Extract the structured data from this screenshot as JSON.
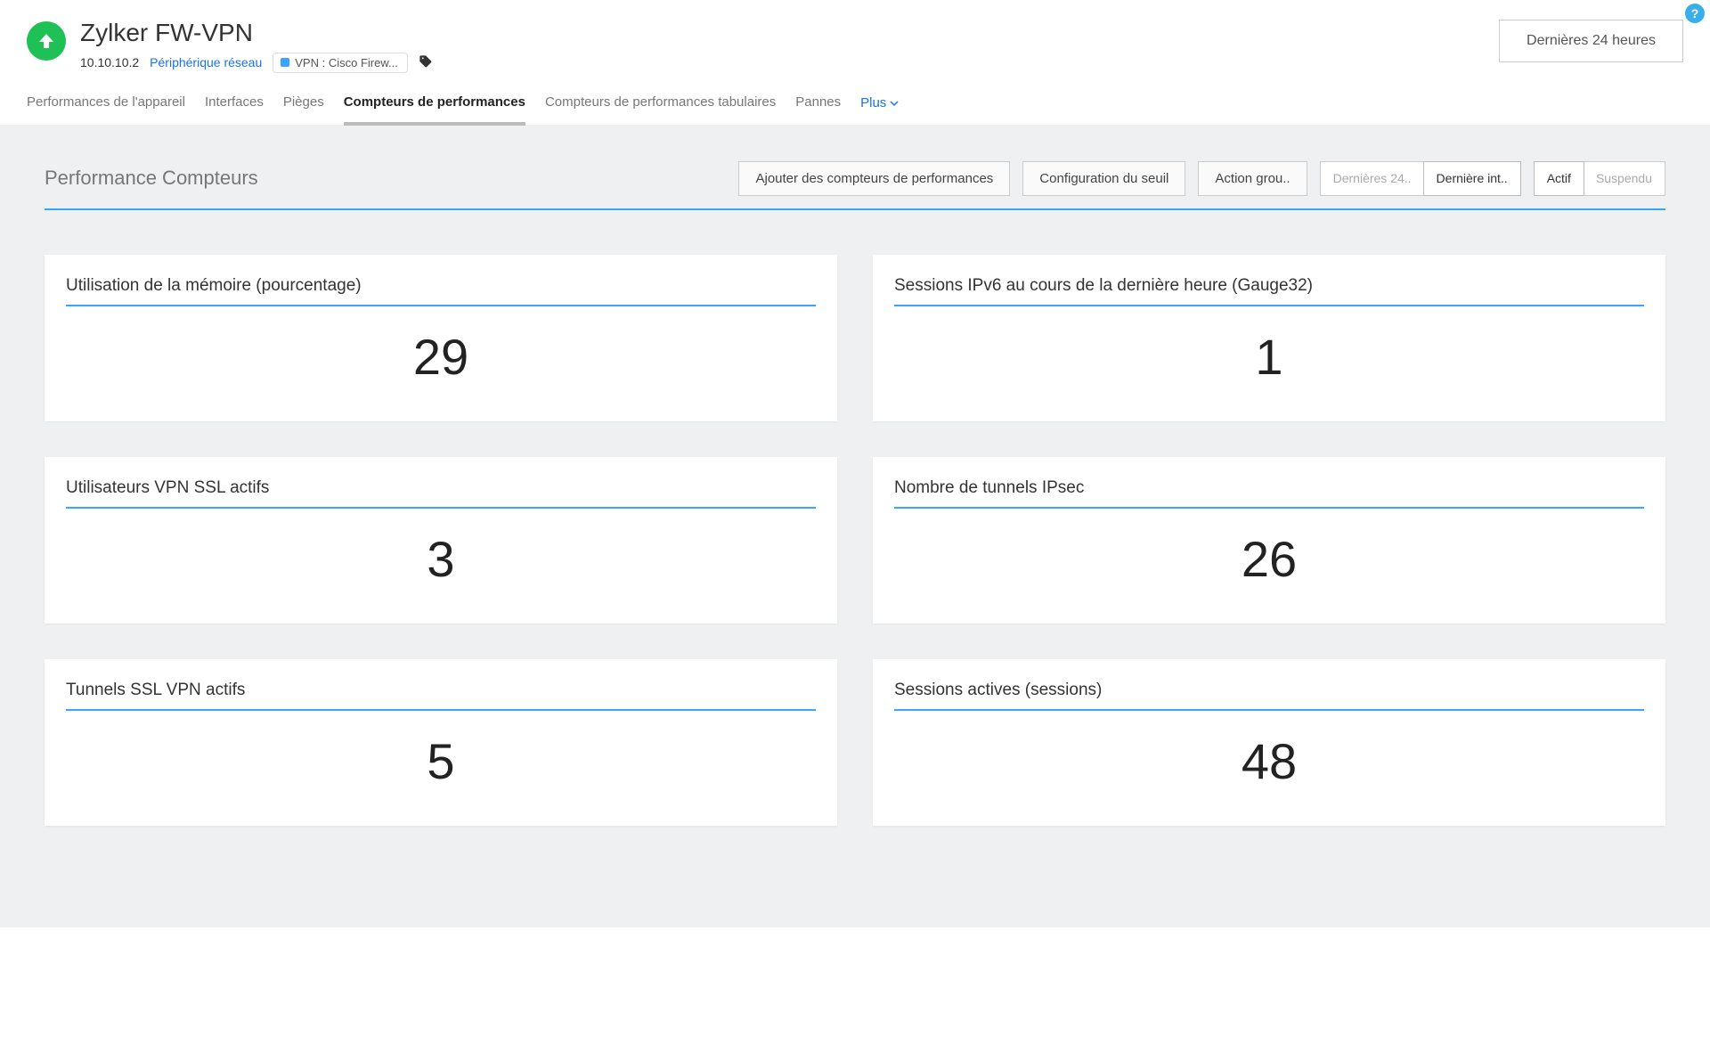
{
  "header": {
    "title": "Zylker FW-VPN",
    "ip": "10.10.10.2",
    "device_link": "Périphérique réseau",
    "chip": "VPN : Cisco Firew...",
    "time_range": "Dernières 24 heures",
    "help": "?"
  },
  "tabs": [
    "Performances de l'appareil",
    "Interfaces",
    "Pièges",
    "Compteurs de performances",
    "Compteurs de performances tabulaires",
    "Pannes"
  ],
  "tabs_more": "Plus",
  "section_title": "Performance Compteurs",
  "toolbar": {
    "add": "Ajouter des compteurs de performances",
    "threshold": "Configuration du seuil",
    "bulk": "Action grou..",
    "range_a": "Dernières 24..",
    "range_b": "Dernière int..",
    "state_a": "Actif",
    "state_b": "Suspendu"
  },
  "cards": [
    {
      "title": "Utilisation de la mémoire (pourcentage)",
      "value": "29"
    },
    {
      "title": "Sessions IPv6 au cours de la dernière heure (Gauge32)",
      "value": "1"
    },
    {
      "title": "Utilisateurs VPN SSL actifs",
      "value": "3"
    },
    {
      "title": "Nombre de tunnels IPsec",
      "value": "26"
    },
    {
      "title": "Tunnels SSL VPN actifs",
      "value": "5"
    },
    {
      "title": "Sessions actives (sessions)",
      "value": "48"
    }
  ]
}
